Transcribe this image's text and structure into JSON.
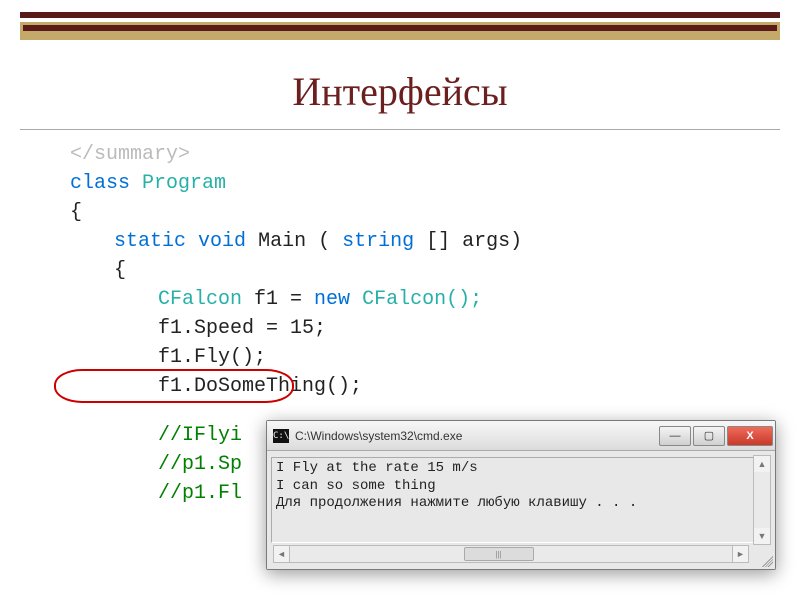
{
  "title": "Интерфейсы",
  "code": {
    "line0": "</summary>",
    "kw_class": "class",
    "type_program": "Program",
    "brace_open": "{",
    "kw_static": "static",
    "kw_void": "void",
    "main_name": "Main",
    "main_args_open": "(",
    "kw_string": "string",
    "main_args_rest": "[] args)",
    "brace_open2": "{",
    "type_cfalcon": "CFalcon",
    "var_f1_eq": " f1 = ",
    "kw_new": "new",
    "ctor_call": " CFalcon();",
    "line_speed": "f1.Speed = 15;",
    "line_fly": "f1.Fly();",
    "line_circled": "f1.DoSomeThing();",
    "comment1": "//IFlyi",
    "comment2": "//p1.Sp",
    "comment3": "//p1.Fl"
  },
  "console": {
    "title": "C:\\Windows\\system32\\cmd.exe",
    "out1": "I Fly at the rate 15 m/s",
    "out2": "I can so some thing",
    "out3": "Для продолжения нажмите любую клавишу . . .",
    "icon_text": "C:\\",
    "btn_min": "—",
    "btn_max": "▢",
    "btn_close": "X",
    "thumb": "|||"
  }
}
